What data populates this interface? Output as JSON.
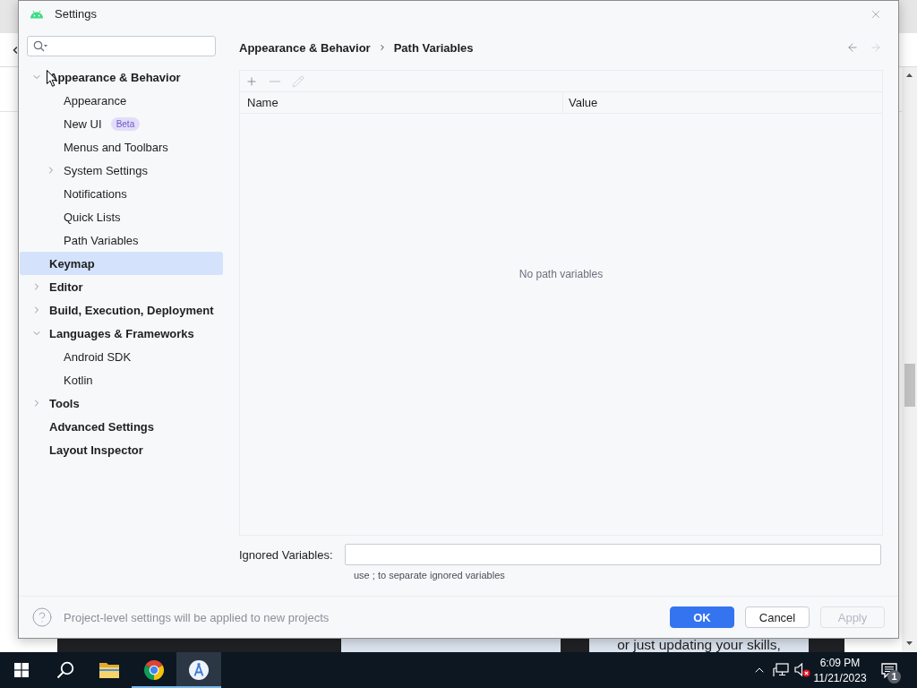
{
  "browser": {
    "page_text": "or just updating your skills,"
  },
  "dialog": {
    "title": "Settings",
    "tree": [
      {
        "label": "Appearance & Behavior",
        "expanded": true,
        "selected": false,
        "children": [
          {
            "label": "Appearance",
            "selected": false
          },
          {
            "label": "New UI",
            "badge": "Beta",
            "selected": false
          },
          {
            "label": "Menus and Toolbars",
            "selected": false
          },
          {
            "label": "System Settings",
            "expanded": false,
            "selected": false
          },
          {
            "label": "Notifications",
            "selected": false
          },
          {
            "label": "Quick Lists",
            "selected": false
          },
          {
            "label": "Path Variables",
            "selected": false
          }
        ]
      },
      {
        "label": "Keymap",
        "selected": true
      },
      {
        "label": "Editor",
        "expanded": false,
        "selected": false
      },
      {
        "label": "Build, Execution, Deployment",
        "expanded": false,
        "selected": false
      },
      {
        "label": "Languages & Frameworks",
        "expanded": true,
        "selected": false,
        "children": [
          {
            "label": "Android SDK",
            "selected": false
          },
          {
            "label": "Kotlin",
            "selected": false
          }
        ]
      },
      {
        "label": "Tools",
        "expanded": false,
        "selected": false
      },
      {
        "label": "Advanced Settings",
        "selected": false
      },
      {
        "label": "Layout Inspector",
        "selected": false
      }
    ],
    "breadcrumb": [
      "Appearance & Behavior",
      "Path Variables"
    ],
    "nav": [
      {
        "kind": "back",
        "disabled": false
      },
      {
        "kind": "forward",
        "disabled": true
      }
    ],
    "table": {
      "toolbar": [
        {
          "kind": "add",
          "disabled": false
        },
        {
          "kind": "remove",
          "disabled": true
        },
        {
          "kind": "edit",
          "disabled": true
        }
      ],
      "columns": [
        "Name",
        "Value"
      ],
      "empty_text": "No path variables"
    },
    "ignored_variables": {
      "label": "Ignored Variables:",
      "help_text": "use ; to separate ignored variables"
    },
    "footer": {
      "note": "Project-level settings will be applied to new projects",
      "buttons": [
        {
          "label": "OK",
          "kind": "primary",
          "disabled": false
        },
        {
          "label": "Cancel",
          "kind": "default",
          "disabled": false
        },
        {
          "label": "Apply",
          "kind": "default",
          "disabled": true
        }
      ]
    }
  },
  "taskbar": {
    "apps": [
      {
        "kind": "file-explorer",
        "running": false,
        "selected": false
      },
      {
        "kind": "browser",
        "running": true,
        "selected": false
      },
      {
        "kind": "android-studio",
        "running": true,
        "selected": true
      }
    ],
    "tray": {
      "volume_muted": true,
      "time": "6:09 PM",
      "date": "11/21/2023",
      "notifications": "1"
    }
  }
}
